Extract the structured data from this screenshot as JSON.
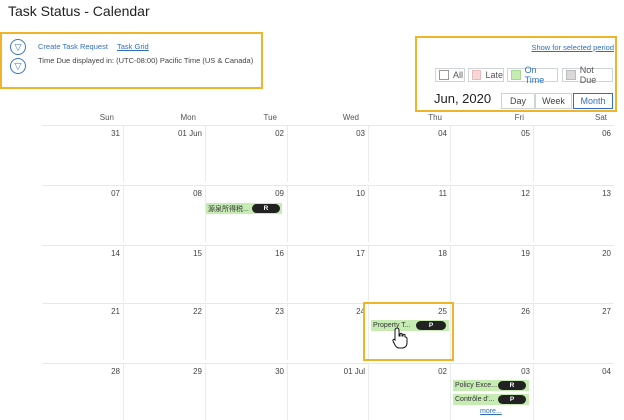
{
  "page": {
    "title": "Task Status - Calendar"
  },
  "toolbar": {
    "create_task_request": "Create Task Request",
    "task_grid": "Task Grid",
    "timezone_text": "Time Due displayed in: (UTC-08:00) Pacific Time (US & Canada)",
    "show_for_selected_period": "Show for selected period"
  },
  "legend": {
    "items": [
      {
        "label": "All",
        "color": "#ffffff"
      },
      {
        "label": "Late",
        "color": "#f8d7d7"
      },
      {
        "label": "On Time",
        "color": "#c6ecb4"
      },
      {
        "label": "Not Due",
        "color": "#d9d9d9"
      }
    ]
  },
  "calendar": {
    "month_title": "Jun, 2020",
    "views": [
      "Day",
      "Week",
      "Month"
    ],
    "selected_view": "Month",
    "days_of_week": [
      "Sun",
      "Mon",
      "Tue",
      "Wed",
      "Thu",
      "Fri",
      "Sat"
    ],
    "weeks": [
      [
        "31",
        "01 Jun",
        "02",
        "03",
        "04",
        "05",
        "06"
      ],
      [
        "07",
        "08",
        "09",
        "10",
        "11",
        "12",
        "13"
      ],
      [
        "14",
        "15",
        "16",
        "17",
        "18",
        "19",
        "20"
      ],
      [
        "21",
        "22",
        "23",
        "24",
        "25",
        "26",
        "27"
      ],
      [
        "28",
        "29",
        "30",
        "01 Jul",
        "02",
        "03",
        "04"
      ]
    ],
    "events": [
      {
        "label": "源泉所得税...",
        "badge": "R"
      },
      {
        "label": "Property T...",
        "badge": "P"
      },
      {
        "label": "Policy Exce...",
        "badge": "R"
      },
      {
        "label": "Contrôle d'...",
        "badge": "P"
      }
    ],
    "more_link": "more..."
  }
}
